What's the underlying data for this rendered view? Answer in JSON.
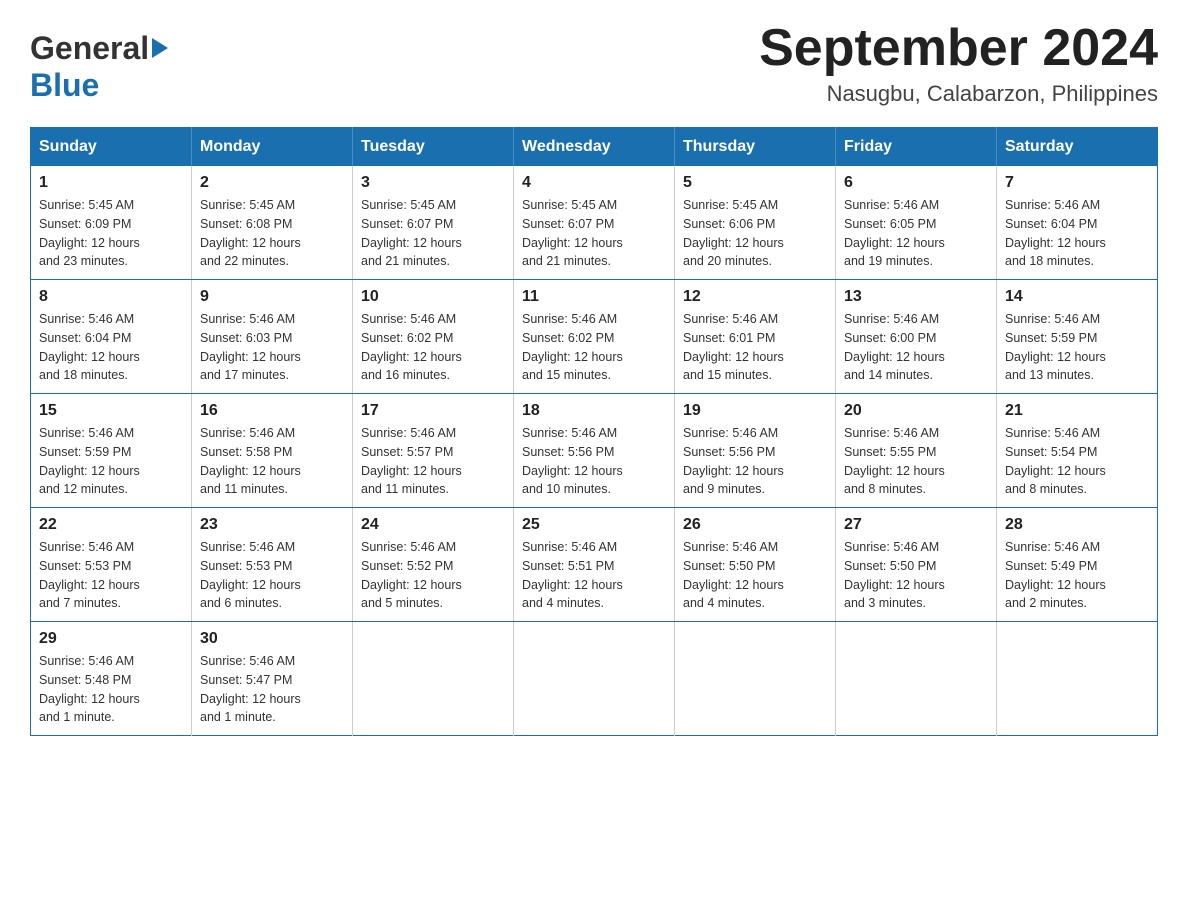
{
  "header": {
    "logo": {
      "general": "General",
      "arrow": "▶",
      "blue": "Blue"
    },
    "title": "September 2024",
    "subtitle": "Nasugbu, Calabarzon, Philippines"
  },
  "days_of_week": [
    "Sunday",
    "Monday",
    "Tuesday",
    "Wednesday",
    "Thursday",
    "Friday",
    "Saturday"
  ],
  "weeks": [
    [
      {
        "day": "1",
        "sunrise": "5:45 AM",
        "sunset": "6:09 PM",
        "daylight": "12 hours and 23 minutes."
      },
      {
        "day": "2",
        "sunrise": "5:45 AM",
        "sunset": "6:08 PM",
        "daylight": "12 hours and 22 minutes."
      },
      {
        "day": "3",
        "sunrise": "5:45 AM",
        "sunset": "6:07 PM",
        "daylight": "12 hours and 21 minutes."
      },
      {
        "day": "4",
        "sunrise": "5:45 AM",
        "sunset": "6:07 PM",
        "daylight": "12 hours and 21 minutes."
      },
      {
        "day": "5",
        "sunrise": "5:45 AM",
        "sunset": "6:06 PM",
        "daylight": "12 hours and 20 minutes."
      },
      {
        "day": "6",
        "sunrise": "5:46 AM",
        "sunset": "6:05 PM",
        "daylight": "12 hours and 19 minutes."
      },
      {
        "day": "7",
        "sunrise": "5:46 AM",
        "sunset": "6:04 PM",
        "daylight": "12 hours and 18 minutes."
      }
    ],
    [
      {
        "day": "8",
        "sunrise": "5:46 AM",
        "sunset": "6:04 PM",
        "daylight": "12 hours and 18 minutes."
      },
      {
        "day": "9",
        "sunrise": "5:46 AM",
        "sunset": "6:03 PM",
        "daylight": "12 hours and 17 minutes."
      },
      {
        "day": "10",
        "sunrise": "5:46 AM",
        "sunset": "6:02 PM",
        "daylight": "12 hours and 16 minutes."
      },
      {
        "day": "11",
        "sunrise": "5:46 AM",
        "sunset": "6:02 PM",
        "daylight": "12 hours and 15 minutes."
      },
      {
        "day": "12",
        "sunrise": "5:46 AM",
        "sunset": "6:01 PM",
        "daylight": "12 hours and 15 minutes."
      },
      {
        "day": "13",
        "sunrise": "5:46 AM",
        "sunset": "6:00 PM",
        "daylight": "12 hours and 14 minutes."
      },
      {
        "day": "14",
        "sunrise": "5:46 AM",
        "sunset": "5:59 PM",
        "daylight": "12 hours and 13 minutes."
      }
    ],
    [
      {
        "day": "15",
        "sunrise": "5:46 AM",
        "sunset": "5:59 PM",
        "daylight": "12 hours and 12 minutes."
      },
      {
        "day": "16",
        "sunrise": "5:46 AM",
        "sunset": "5:58 PM",
        "daylight": "12 hours and 11 minutes."
      },
      {
        "day": "17",
        "sunrise": "5:46 AM",
        "sunset": "5:57 PM",
        "daylight": "12 hours and 11 minutes."
      },
      {
        "day": "18",
        "sunrise": "5:46 AM",
        "sunset": "5:56 PM",
        "daylight": "12 hours and 10 minutes."
      },
      {
        "day": "19",
        "sunrise": "5:46 AM",
        "sunset": "5:56 PM",
        "daylight": "12 hours and 9 minutes."
      },
      {
        "day": "20",
        "sunrise": "5:46 AM",
        "sunset": "5:55 PM",
        "daylight": "12 hours and 8 minutes."
      },
      {
        "day": "21",
        "sunrise": "5:46 AM",
        "sunset": "5:54 PM",
        "daylight": "12 hours and 8 minutes."
      }
    ],
    [
      {
        "day": "22",
        "sunrise": "5:46 AM",
        "sunset": "5:53 PM",
        "daylight": "12 hours and 7 minutes."
      },
      {
        "day": "23",
        "sunrise": "5:46 AM",
        "sunset": "5:53 PM",
        "daylight": "12 hours and 6 minutes."
      },
      {
        "day": "24",
        "sunrise": "5:46 AM",
        "sunset": "5:52 PM",
        "daylight": "12 hours and 5 minutes."
      },
      {
        "day": "25",
        "sunrise": "5:46 AM",
        "sunset": "5:51 PM",
        "daylight": "12 hours and 4 minutes."
      },
      {
        "day": "26",
        "sunrise": "5:46 AM",
        "sunset": "5:50 PM",
        "daylight": "12 hours and 4 minutes."
      },
      {
        "day": "27",
        "sunrise": "5:46 AM",
        "sunset": "5:50 PM",
        "daylight": "12 hours and 3 minutes."
      },
      {
        "day": "28",
        "sunrise": "5:46 AM",
        "sunset": "5:49 PM",
        "daylight": "12 hours and 2 minutes."
      }
    ],
    [
      {
        "day": "29",
        "sunrise": "5:46 AM",
        "sunset": "5:48 PM",
        "daylight": "12 hours and 1 minute."
      },
      {
        "day": "30",
        "sunrise": "5:46 AM",
        "sunset": "5:47 PM",
        "daylight": "12 hours and 1 minute."
      },
      null,
      null,
      null,
      null,
      null
    ]
  ],
  "labels": {
    "sunrise": "Sunrise:",
    "sunset": "Sunset:",
    "daylight": "Daylight:"
  }
}
